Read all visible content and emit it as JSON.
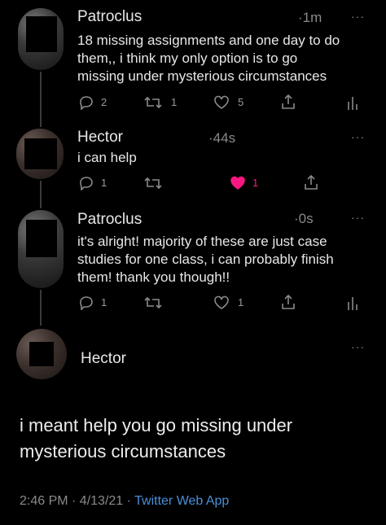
{
  "tweets": [
    {
      "author": "Patroclus",
      "time": "·1m",
      "text": [
        "18 missing assignments and one day to do",
        "them,, i think my only option is to go",
        "missing under mysterious circumstances"
      ],
      "replies": "2",
      "retweets": "1",
      "likes": "5",
      "liked": false
    },
    {
      "author": "Hector",
      "time": "·44s",
      "text": [
        "i can help"
      ],
      "replies": "1",
      "retweets": "",
      "likes": "1",
      "liked": true
    },
    {
      "author": "Patroclus",
      "time": "·0s",
      "text": [
        "it's alright! majority of these are just case",
        "studies for one class, i can probably finish",
        "them! thank you though!!"
      ],
      "replies": "1",
      "retweets": "",
      "likes": "1",
      "liked": false
    }
  ],
  "main_tweet": {
    "author": "Hector",
    "text": [
      "i meant help you go missing under",
      "mysterious circumstances"
    ],
    "timestamp": "2:46 PM · 4/13/21 · ",
    "source": "Twitter Web App"
  },
  "more_glyph": "···",
  "colors": {
    "like_red": "#f91880",
    "link_blue": "#4a8fd8",
    "muted": "#8a8a8a"
  }
}
